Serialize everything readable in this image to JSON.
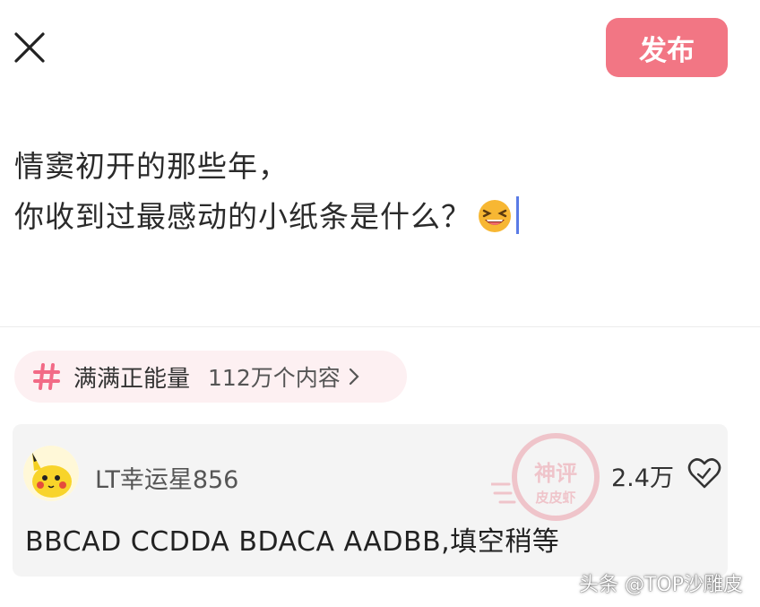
{
  "header": {
    "close_icon": "close-icon",
    "publish_label": "发布",
    "publish_color": "#f27684"
  },
  "post": {
    "line1": "情窦初开的那些年，",
    "line2": "你收到过最感动的小纸条是什么？",
    "emoji_icon": "laughing-emoji-icon"
  },
  "topic": {
    "hash_icon": "hash-icon",
    "name": "满满正能量",
    "count": "112万个内容",
    "chevron_icon": "chevron-right-icon"
  },
  "comment": {
    "username": "LT幸运星856",
    "likes": "2.4万",
    "text": "BBCAD CCDDA BDACA AADBB,填空稍等",
    "like_icon": "heart-icon"
  },
  "stamp": {
    "line1": "神评",
    "line2": "皮皮虾"
  },
  "watermark": "头条 @TOP沙雕皮"
}
